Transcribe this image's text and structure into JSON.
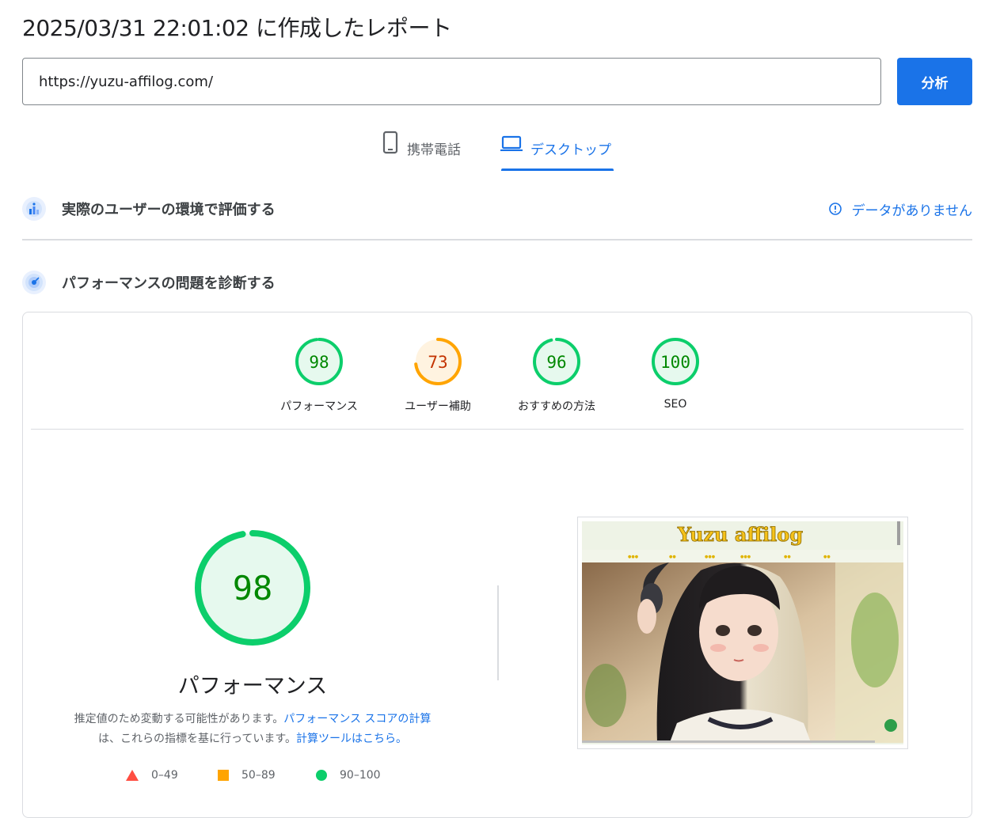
{
  "header": {
    "report_title": "2025/03/31 22:01:02 に作成したレポート",
    "url_value": "https://yuzu-affilog.com/",
    "analyze_label": "分析"
  },
  "tabs": [
    {
      "label": "携帯電話",
      "icon": "phone-icon",
      "active": false
    },
    {
      "label": "デスクトップ",
      "icon": "laptop-icon",
      "active": true
    }
  ],
  "field_data": {
    "title": "実際のユーザーの環境で評価する",
    "status": "データがありません",
    "status_icon": "info-icon"
  },
  "lab_data": {
    "title": "パフォーマンスの問題を診断する"
  },
  "scores": [
    {
      "label": "パフォーマンス",
      "value": 98,
      "color": "#0cce6b",
      "text_color": "#008800",
      "bg": "#e6f9ee"
    },
    {
      "label": "ユーザー補助",
      "value": 73,
      "color": "#ffa400",
      "text_color": "#c33300",
      "bg": "#fff3e0"
    },
    {
      "label": "おすすめの方法",
      "value": 96,
      "color": "#0cce6b",
      "text_color": "#008800",
      "bg": "#e6f9ee"
    },
    {
      "label": "SEO",
      "value": 100,
      "color": "#0cce6b",
      "text_color": "#008800",
      "bg": "#e6f9ee"
    }
  ],
  "performance": {
    "score": 98,
    "title": "パフォーマンス",
    "desc_prefix": "推定値のため変動する可能性があります。",
    "desc_link1": "パフォーマンス スコアの計算",
    "desc_middle": "は、これらの指標を基に行っています。",
    "desc_link2": "計算ツールはこちら。"
  },
  "legend": [
    {
      "shape": "triangle",
      "color": "#ff4e42",
      "range": "0–49"
    },
    {
      "shape": "square",
      "color": "#ffa400",
      "range": "50–89"
    },
    {
      "shape": "circle",
      "color": "#0cce6b",
      "range": "90–100"
    }
  ],
  "screenshot": {
    "site_logo": "Yuzu affilog"
  }
}
